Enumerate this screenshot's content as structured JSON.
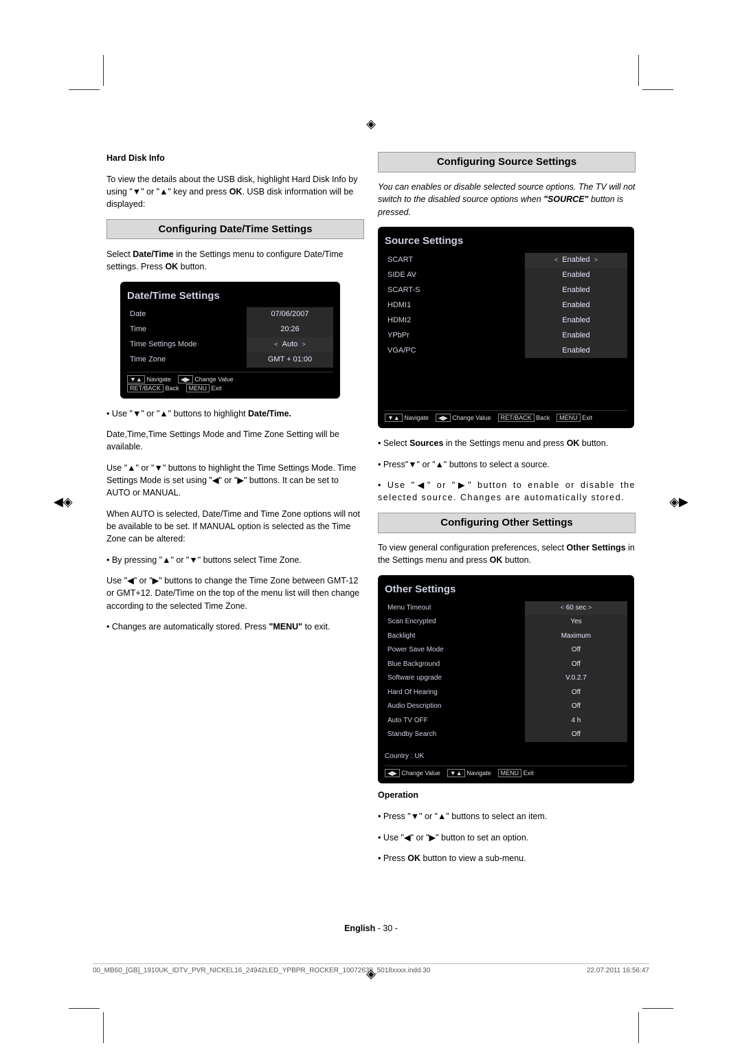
{
  "printmark_glyph": "◈",
  "sideglyph_l": "◀◈",
  "sideglyph_r": "◈▶",
  "hard_disk_heading": "Hard Disk Info",
  "hard_disk_body_1": "To view the details about the USB disk, highlight Hard Disk Info by using \"▼\" or \"▲\" key and press ",
  "hard_disk_ok": "OK",
  "hard_disk_body_2": ". USB disk information will be displayed:",
  "datetime_bar": "Configuring Date/Time Settings",
  "datetime_para_1a": "Select ",
  "datetime_para_1b": "Date/Time",
  "datetime_para_1c": " in the Settings menu to configure Date/Time settings. Press ",
  "datetime_para_1d": "OK",
  "datetime_para_1e": " button.",
  "dt_osd": {
    "title": "Date/Time Settings",
    "rows": [
      {
        "label": "Date",
        "value": "07/06/2007"
      },
      {
        "label": "Time",
        "value": "20:26"
      },
      {
        "label": "Time Settings Mode",
        "value": "Auto"
      },
      {
        "label": "Time Zone",
        "value": "GMT + 01:00"
      }
    ],
    "nav1_icon": "▼▲",
    "nav1": " Navigate",
    "nav2_icon": "◀▶",
    "nav2": " Change Value",
    "back_box": "RET/BACK",
    "back_label": " Back",
    "menu_box": "MENU",
    "menu_label": " Exit"
  },
  "dt_b1": "• Use \"▼\" or \"▲\" buttons to highlight ",
  "dt_b1b": "Date/Time.",
  "dt_p2": "Date,Time,Time Settings Mode and Time Zone Setting will be available.",
  "dt_p3": "Use \"▲\" or \"▼\" buttons to highlight the Time Settings Mode. Time Settings Mode is set using \"◀\" or \"▶\" buttons. It can be set to AUTO or MANUAL.",
  "dt_p4": "When AUTO is selected, Date/Time and Time Zone options will not be available to be set. If MANUAL option is selected as the Time Zone can be altered:",
  "dt_b2": "• By pressing \"▲\" or \"▼\" buttons select Time Zone.",
  "dt_p5": "Use \"◀\" or \"▶\" buttons to change the Time Zone between GMT-12 or GMT+12. Date/Time on the top of the menu list will then change according to the selected Time Zone.",
  "dt_b3a": "• Changes are automatically stored. Press ",
  "dt_b3b": "\"MENU\"",
  "dt_b3c": " to exit.",
  "source_bar": "Configuring Source Settings",
  "source_intro_i": "You can enables or disable selected source options. The TV will not switch to the disabled source options when ",
  "source_intro_b": "\"SOURCE\"",
  "source_intro_c": " button is pressed.",
  "src_osd": {
    "title": "Source Settings",
    "rows": [
      {
        "label": "SCART",
        "value": "Enabled"
      },
      {
        "label": "SIDE AV",
        "value": "Enabled"
      },
      {
        "label": "SCART-S",
        "value": "Enabled"
      },
      {
        "label": "HDMI1",
        "value": "Enabled"
      },
      {
        "label": "HDMI2",
        "value": "Enabled"
      },
      {
        "label": "YPbPr",
        "value": "Enabled"
      },
      {
        "label": "VGA/PC",
        "value": "Enabled"
      }
    ],
    "nav1_icon": "▼▲",
    "nav1": " Navigate",
    "nav2_icon": "◀▶",
    "nav2": " Change Value",
    "back_box": "RET/BACK",
    "back_label": " Back",
    "menu_box": "MENU",
    "menu_label": " Exit"
  },
  "src_b1a": "• Select ",
  "src_b1b": "Sources",
  "src_b1c": " in the Settings menu and press ",
  "src_b1d": "OK",
  "src_b1e": " button.",
  "src_b2": "• Press\"▼\" or \"▲\" buttons to select a source.",
  "src_b3": "• Use \"◀\" or \"▶\" button to enable or disable the selected source. Changes are automatically stored.",
  "other_bar": "Configuring Other Settings",
  "other_p1a": "To view general configuration preferences, select ",
  "other_p1b": "Other Settings",
  "other_p1c": " in the Settings menu and press ",
  "other_p1d": "OK",
  "other_p1e": " button.",
  "oth_osd": {
    "title": "Other Settings",
    "rows": [
      {
        "label": "Menu Timeout",
        "value": "60 sec"
      },
      {
        "label": "Scan Encrypted",
        "value": "Yes"
      },
      {
        "label": "Backlight",
        "value": "Maximum"
      },
      {
        "label": "Power Save Mode",
        "value": "Off"
      },
      {
        "label": "Blue Background",
        "value": "Off"
      },
      {
        "label": "Software upgrade",
        "value": "V.0.2.7"
      },
      {
        "label": "Hard Of Hearing",
        "value": "Off"
      },
      {
        "label": "Audio Description",
        "value": "Off"
      },
      {
        "label": "Auto TV OFF",
        "value": "4 h"
      },
      {
        "label": "Standby Search",
        "value": "Off"
      }
    ],
    "country": "Country : UK",
    "nav2_icon": "◀▶",
    "nav2": " Change Value",
    "nav1_icon": "▼▲",
    "nav1": " Navigate",
    "menu_box": "MENU",
    "menu_label": " Exit"
  },
  "op_heading": "Operation",
  "op_b1": "• Press \"▼\" or \"▲\" buttons to select an item.",
  "op_b2": "• Use \"◀\" or \"▶\" button to set an option.",
  "op_b3a": "• Press ",
  "op_b3b": "OK",
  "op_b3c": " button to view a sub-menu.",
  "footer_lang": "English",
  "footer_page": "   - 30 -",
  "imprint_file": "00_MB60_[GB]_1910UK_IDTV_PVR_NICKEL16_24942LED_YPBPR_ROCKER_10072638_5018xxxx.indd   30",
  "imprint_date": "22.07.2011   16:56:47"
}
